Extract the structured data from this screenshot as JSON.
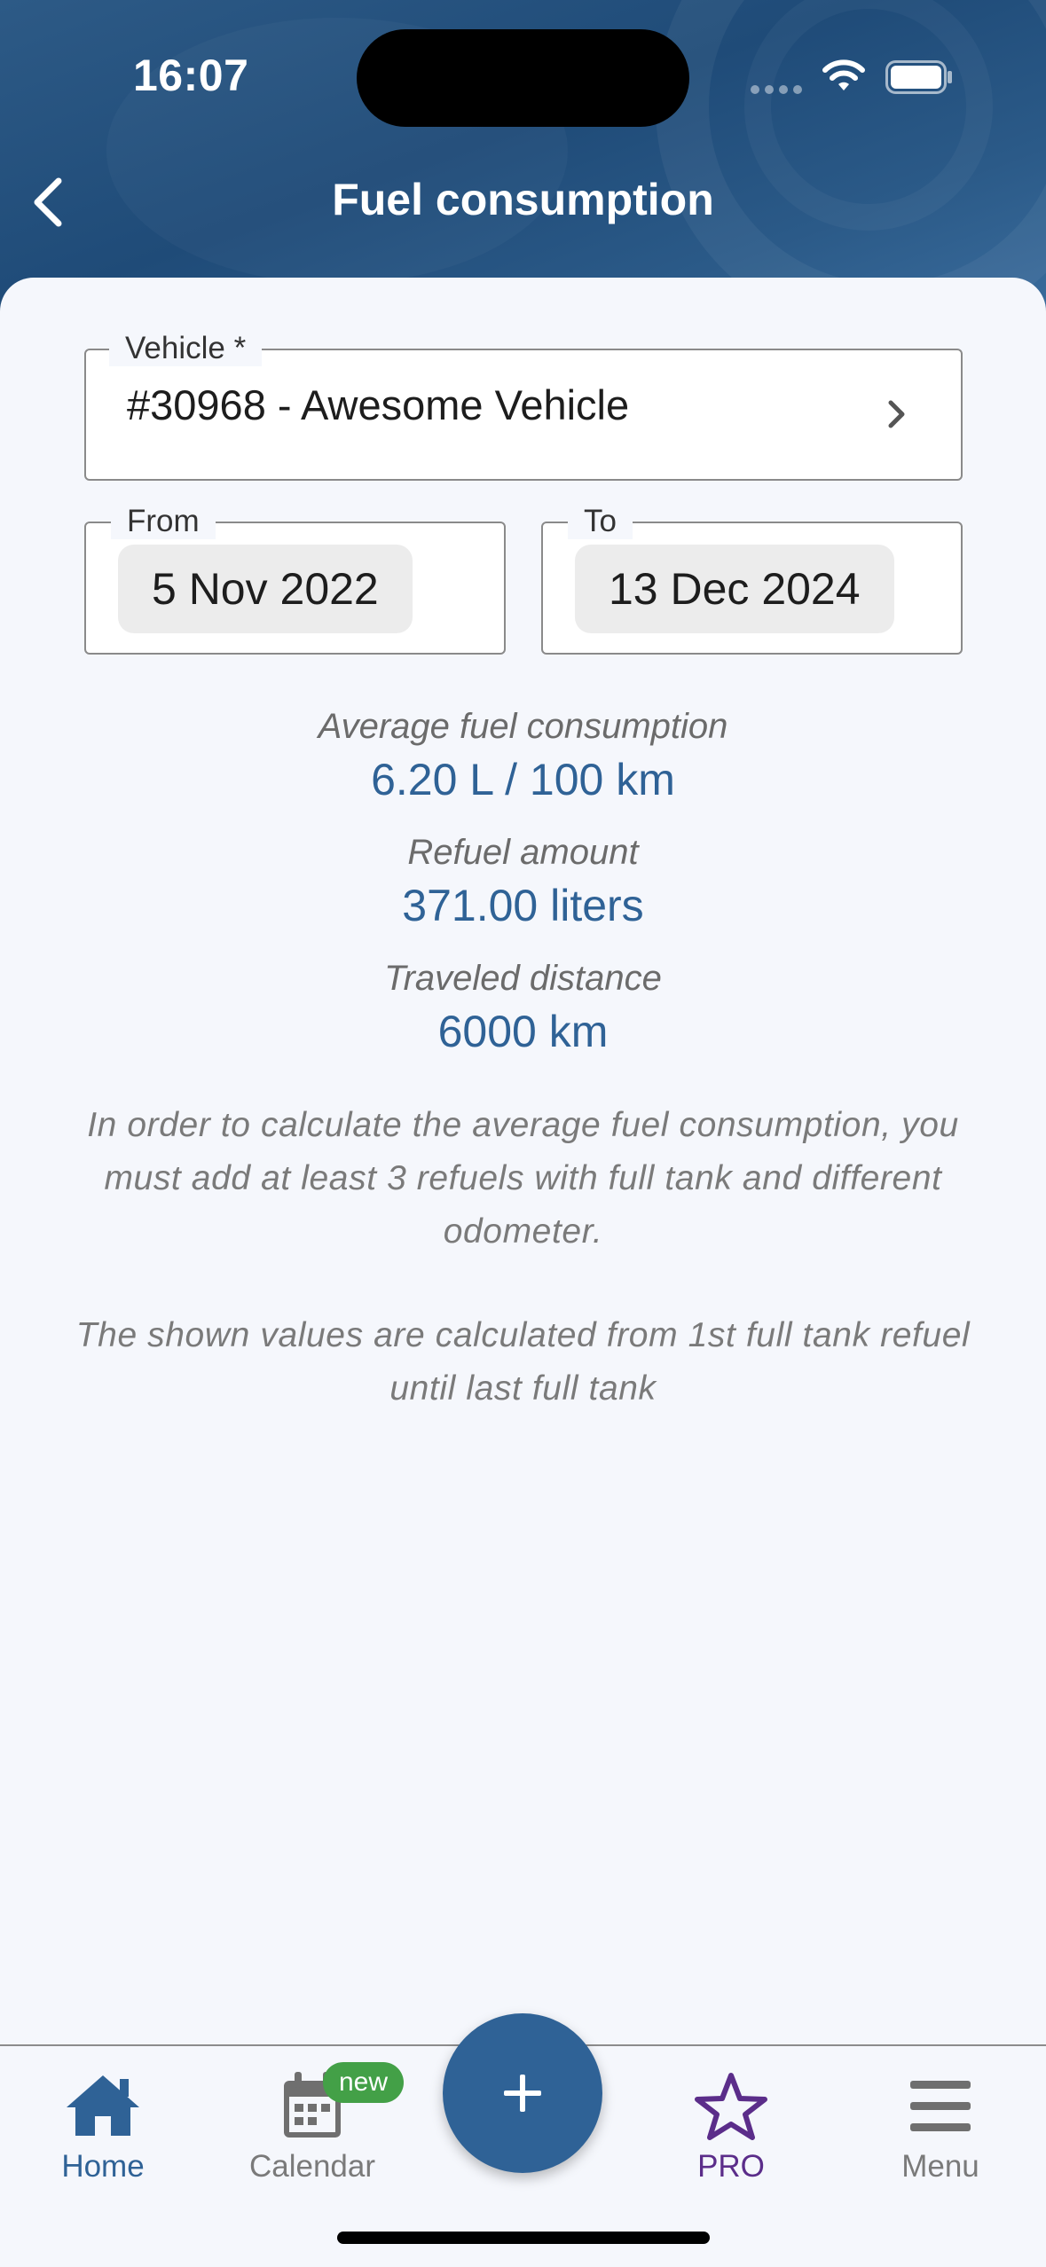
{
  "status_bar": {
    "time": "16:07"
  },
  "header": {
    "title": "Fuel consumption"
  },
  "vehicle": {
    "label": "Vehicle *",
    "value": "#30968 - Awesome Vehicle"
  },
  "date_range": {
    "from_label": "From",
    "from_value": "5 Nov 2022",
    "to_label": "To",
    "to_value": "13 Dec 2024"
  },
  "stats": [
    {
      "label": "Average fuel consumption",
      "value": "6.20 L / 100 km"
    },
    {
      "label": "Refuel amount",
      "value": "371.00 liters"
    },
    {
      "label": "Traveled distance",
      "value": "6000 km"
    }
  ],
  "notes": [
    "In order to calculate the average fuel consumption, you must add at least 3 refuels with full tank and different odometer.",
    "The shown values are calculated from 1st full tank refuel until last full tank"
  ],
  "bottom_nav": {
    "items": [
      {
        "label": "Home",
        "icon": "home-icon"
      },
      {
        "label": "Calendar",
        "icon": "calendar-icon",
        "badge": "new"
      },
      {
        "label": "PRO",
        "icon": "star-icon"
      },
      {
        "label": "Menu",
        "icon": "menu-icon"
      }
    ],
    "fab_icon": "plus-icon"
  },
  "colors": {
    "primary": "#2f6296",
    "header_bg": "#1f4b78",
    "pro": "#5b2d8a",
    "badge": "#43a047",
    "background": "#f5f7fc"
  }
}
